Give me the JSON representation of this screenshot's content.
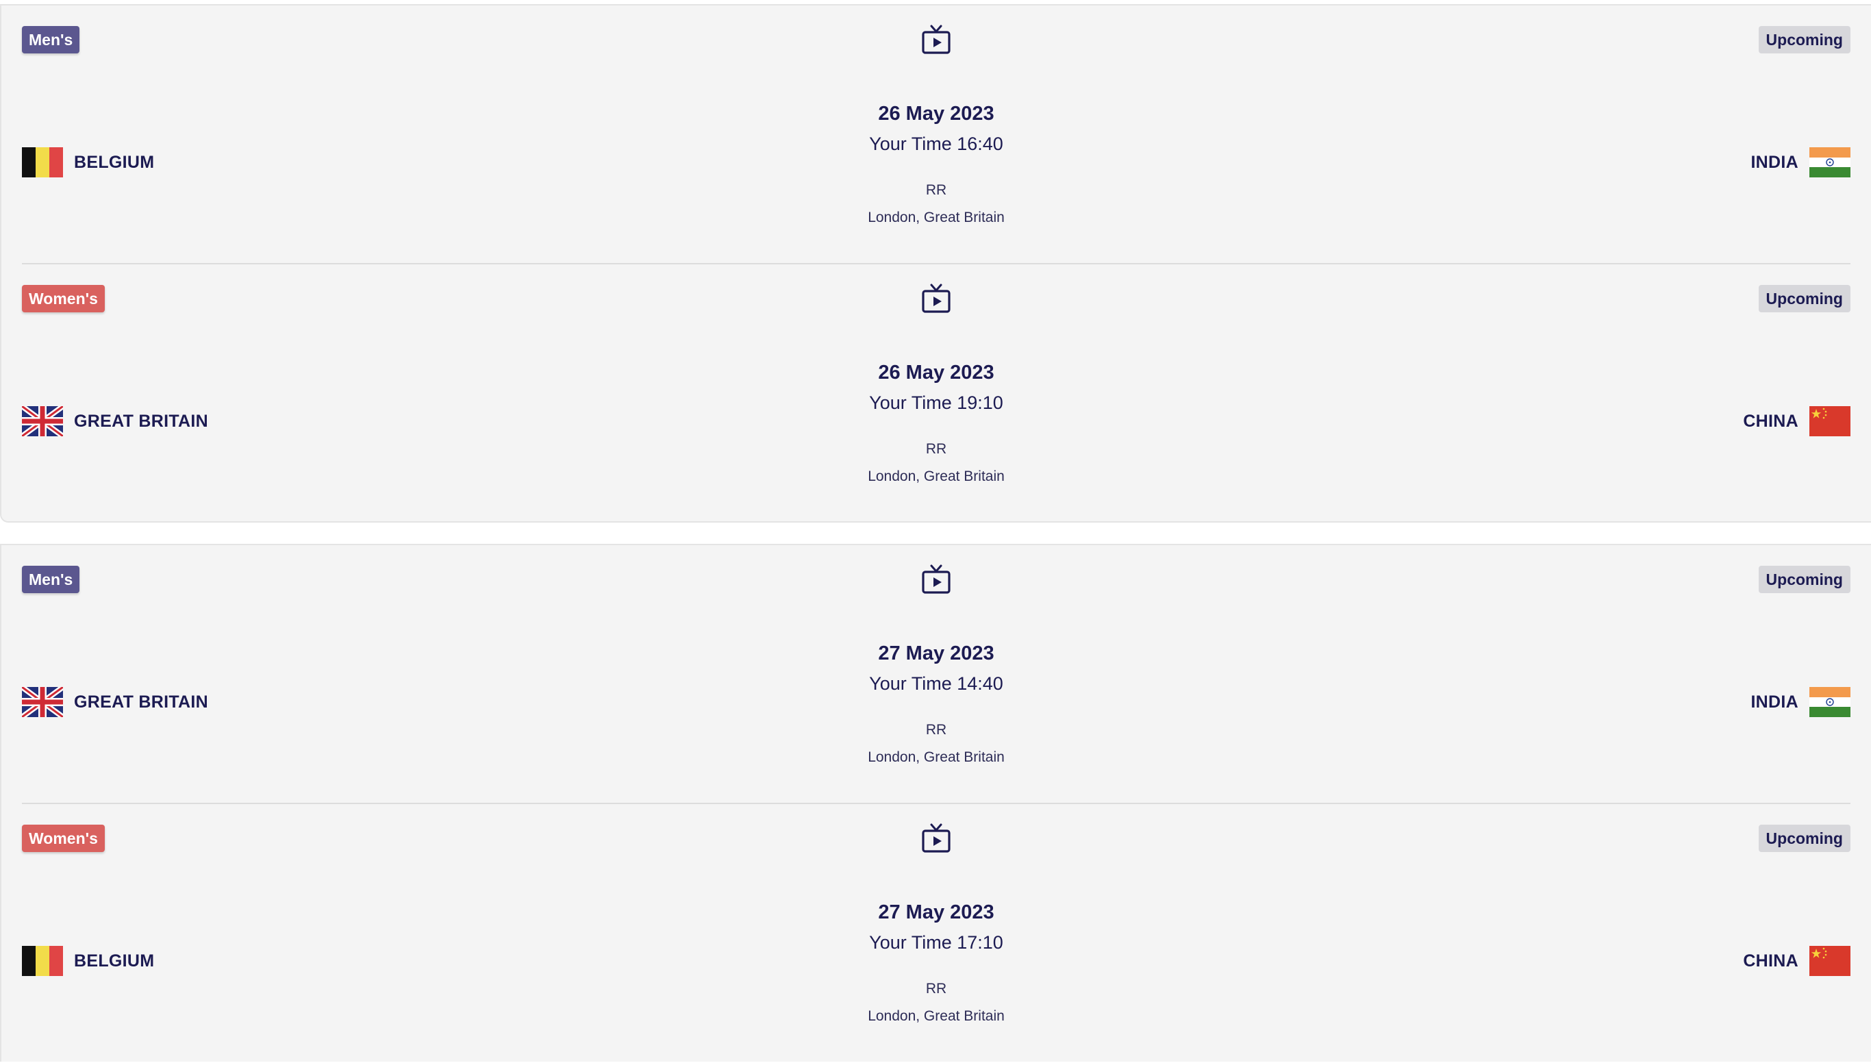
{
  "days": [
    {
      "matches": [
        {
          "gender": "Men's",
          "gender_type": "mens",
          "status": "Upcoming",
          "date": "26 May 2023",
          "time": "Your Time 16:40",
          "round": "RR",
          "venue": "London, Great Britain",
          "home": {
            "name": "BELGIUM",
            "flag": "belgium-flag-icon"
          },
          "away": {
            "name": "INDIA",
            "flag": "india-flag-icon"
          }
        },
        {
          "gender": "Women's",
          "gender_type": "womens",
          "status": "Upcoming",
          "date": "26 May 2023",
          "time": "Your Time 19:10",
          "round": "RR",
          "venue": "London, Great Britain",
          "home": {
            "name": "GREAT BRITAIN",
            "flag": "great-britain-flag-icon"
          },
          "away": {
            "name": "CHINA",
            "flag": "china-flag-icon"
          }
        }
      ]
    },
    {
      "matches": [
        {
          "gender": "Men's",
          "gender_type": "mens",
          "status": "Upcoming",
          "date": "27 May 2023",
          "time": "Your Time 14:40",
          "round": "RR",
          "venue": "London, Great Britain",
          "home": {
            "name": "GREAT BRITAIN",
            "flag": "great-britain-flag-icon"
          },
          "away": {
            "name": "INDIA",
            "flag": "india-flag-icon"
          }
        },
        {
          "gender": "Women's",
          "gender_type": "womens",
          "status": "Upcoming",
          "date": "27 May 2023",
          "time": "Your Time 17:10",
          "round": "RR",
          "venue": "London, Great Britain",
          "home": {
            "name": "BELGIUM",
            "flag": "belgium-flag-icon"
          },
          "away": {
            "name": "CHINA",
            "flag": "china-flag-icon"
          }
        }
      ]
    }
  ],
  "colors": {
    "mens_badge": "#5b578f",
    "womens_badge": "#d9615e",
    "status_badge": "#d7d7db",
    "text_primary": "#1c1b52",
    "card_background": "#f4f4f4"
  }
}
